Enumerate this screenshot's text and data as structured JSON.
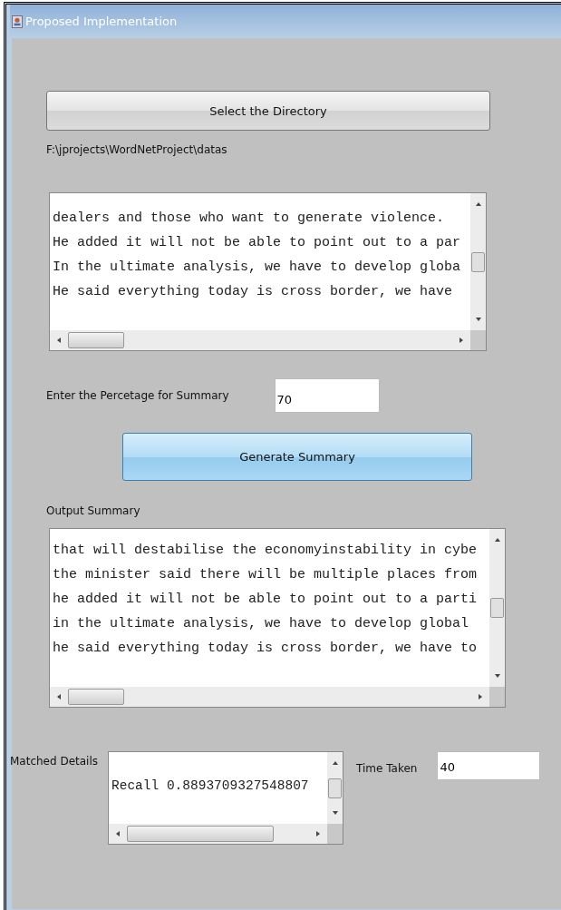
{
  "window": {
    "title": "Proposed Implementation"
  },
  "select_button": {
    "label": "Select the Directory"
  },
  "directory_path": "F:\\jprojects\\WordNetProject\\datas",
  "input_text": {
    "lines": [
      "dealers and those who want to generate violence.",
      "He added it will not be able to point out to a par",
      "In the ultimate analysis, we have to develop globa",
      "He said everything today is cross border, we have"
    ]
  },
  "percentage": {
    "label": "Enter the  Percetage for Summary",
    "value": "70"
  },
  "generate_button": {
    "label": "Generate Summary"
  },
  "output": {
    "label": "Output Summary",
    "lines": [
      "that will destabilise the economyinstability in cybe",
      "the minister said there will be multiple places from",
      "he added it will not be able to point out to a parti",
      "in the ultimate analysis, we have to develop global",
      "he said everything today is cross border, we have to"
    ]
  },
  "matched": {
    "label": "Matched Details",
    "lines": [
      "Recall 0.8893709327548807"
    ]
  },
  "time_taken": {
    "label": "Time Taken",
    "value": "40"
  }
}
